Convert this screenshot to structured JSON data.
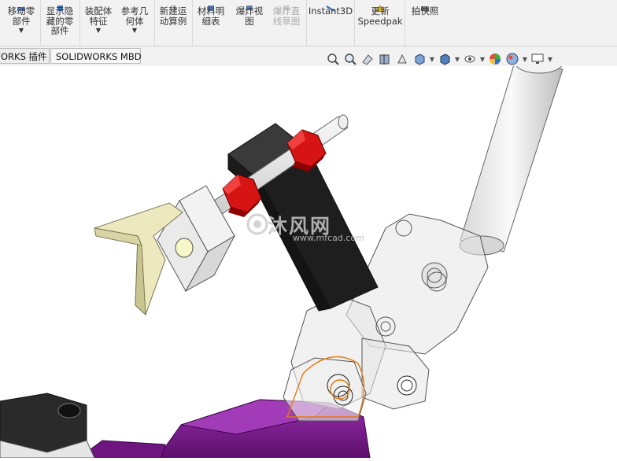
{
  "ribbon": {
    "buttons": [
      {
        "label": "移动零\n部件",
        "dropdown": true,
        "disabled": false
      },
      {
        "label": "显示隐\n藏的零\n部件",
        "dropdown": false,
        "disabled": false
      },
      {
        "label": "装配体\n特征",
        "dropdown": true,
        "disabled": false
      },
      {
        "label": "参考几\n何体",
        "dropdown": true,
        "disabled": false
      },
      {
        "label": "新建运\n动算例",
        "dropdown": false,
        "disabled": false
      },
      {
        "label": "材料明\n细表",
        "dropdown": false,
        "disabled": false
      },
      {
        "label": "爆炸视\n图",
        "dropdown": false,
        "disabled": false
      },
      {
        "label": "爆炸直\n线草图",
        "dropdown": false,
        "disabled": true
      },
      {
        "label": "Instant3D",
        "dropdown": false,
        "disabled": false
      },
      {
        "label": "更新\nSpeedpak",
        "dropdown": false,
        "disabled": false
      },
      {
        "label": "拍快照",
        "dropdown": false,
        "disabled": false
      }
    ]
  },
  "tabs": [
    {
      "label": "ORKS 插件"
    },
    {
      "label": "SOLIDWORKS MBD"
    }
  ],
  "heads_up_toolbar": [
    "zoom-to-fit-icon",
    "zoom-to-area-icon",
    "previous-view-icon",
    "section-view-icon",
    "dynamic-annotation-icon",
    "view-orientation-icon",
    "display-style-icon",
    "hide-show-items-icon",
    "edit-appearance-icon",
    "apply-scene-icon",
    "view-settings-icon"
  ],
  "watermark": {
    "text": "沐风网",
    "url": "www.mfcad.com"
  },
  "colors": {
    "purple_base": "#7a1a8c",
    "red_nut": "#cc1111",
    "black_block": "#1e1e1e",
    "cream_part": "#ece9bf",
    "orange_selection": "#e07a10"
  }
}
